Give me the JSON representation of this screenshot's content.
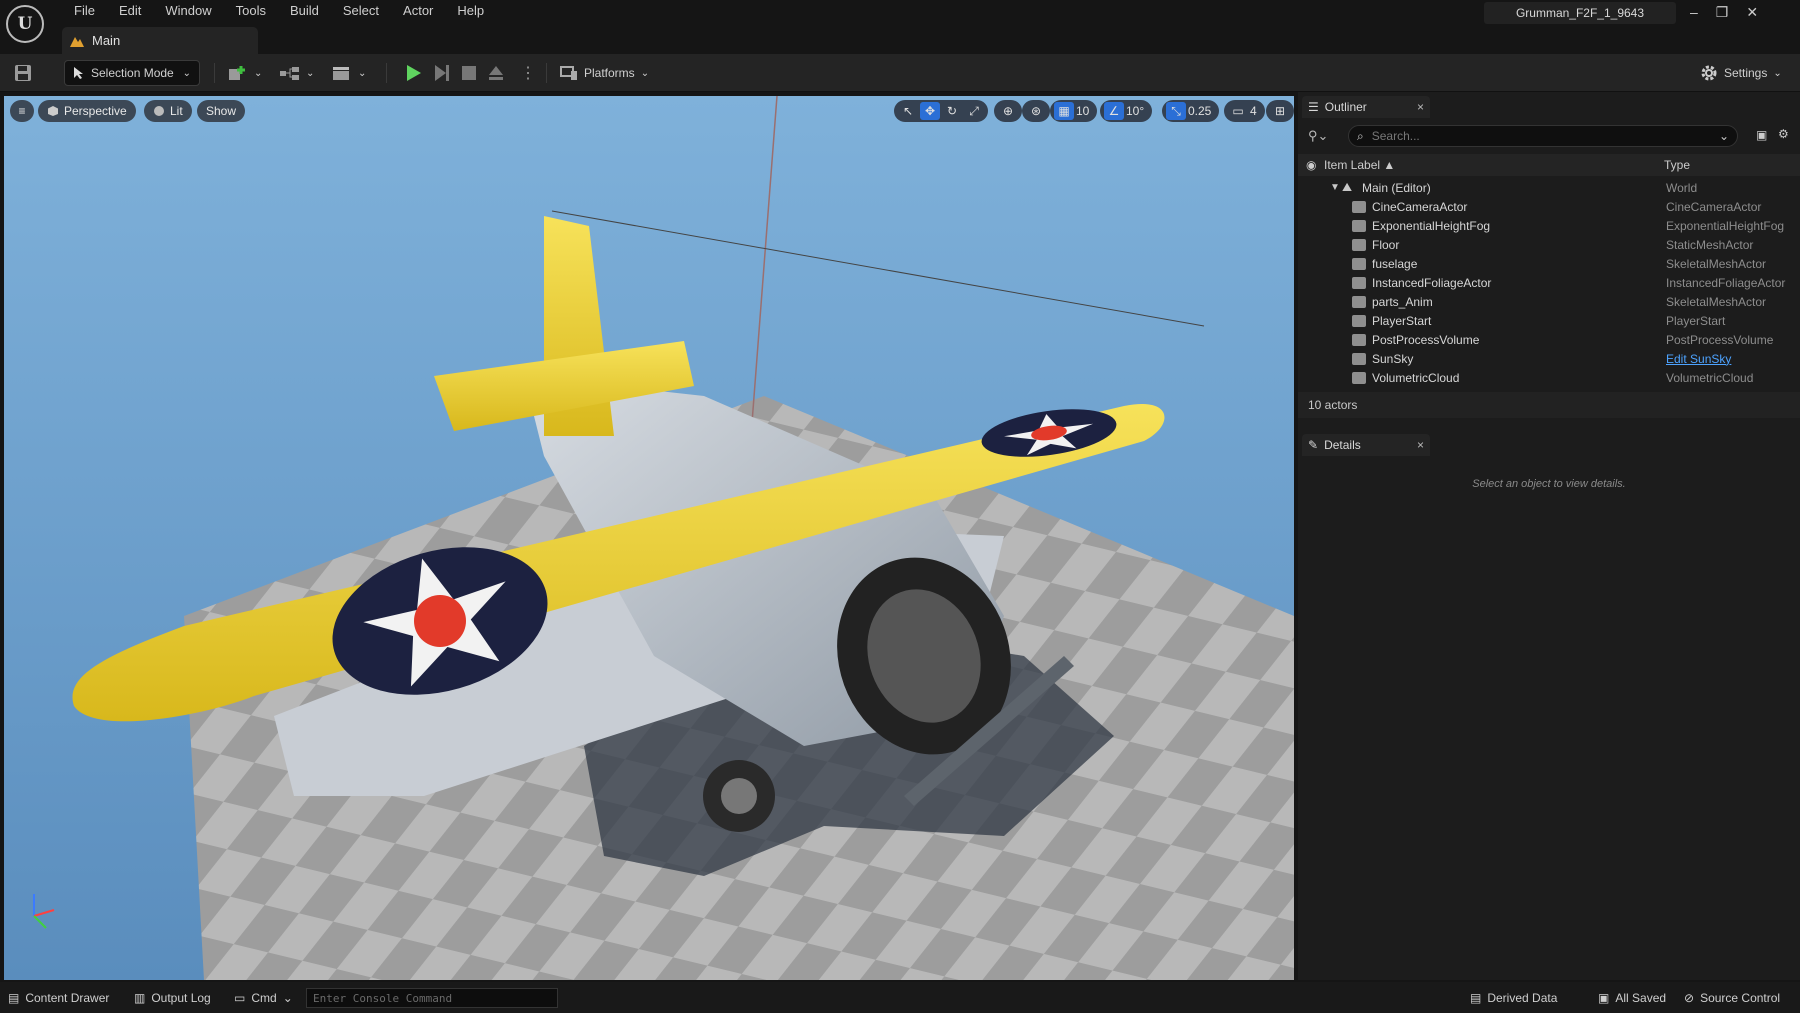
{
  "menu": {
    "items": [
      "File",
      "Edit",
      "Window",
      "Tools",
      "Build",
      "Select",
      "Actor",
      "Help"
    ]
  },
  "app": {
    "logo": "U",
    "project_name": "Grumman_F2F_1_9643",
    "doc_tab": "Main"
  },
  "window_controls": {
    "minimize": "–",
    "restore": "❐",
    "close": "✕"
  },
  "toolbar": {
    "selection_mode": "Selection Mode",
    "platforms": "Platforms",
    "settings": "Settings"
  },
  "viewport": {
    "menu_icon": "≡",
    "perspective": "Perspective",
    "lit": "Lit",
    "show": "Show",
    "grid_snap": "10",
    "rotate_snap": "10°",
    "scale_snap": "0.25",
    "camera_speed": "4"
  },
  "outliner": {
    "title": "Outliner",
    "close": "×",
    "search_placeholder": "Search...",
    "col_label": "Item Label ▲",
    "col_type": "Type",
    "root": {
      "label": "Main (Editor)",
      "type": "World"
    },
    "rows": [
      {
        "label": "CineCameraActor",
        "type": "CineCameraActor"
      },
      {
        "label": "ExponentialHeightFog",
        "type": "ExponentialHeightFog"
      },
      {
        "label": "Floor",
        "type": "StaticMeshActor"
      },
      {
        "label": "fuselage",
        "type": "SkeletalMeshActor"
      },
      {
        "label": "InstancedFoliageActor",
        "type": "InstancedFoliageActor"
      },
      {
        "label": "parts_Anim",
        "type": "SkeletalMeshActor"
      },
      {
        "label": "PlayerStart",
        "type": "PlayerStart"
      },
      {
        "label": "PostProcessVolume",
        "type": "PostProcessVolume"
      },
      {
        "label": "SunSky",
        "type": "Edit SunSky"
      },
      {
        "label": "VolumetricCloud",
        "type": "VolumetricCloud"
      }
    ],
    "count": "10 actors"
  },
  "details": {
    "title": "Details",
    "close": "×",
    "hint": "Select an object to view details."
  },
  "statusbar": {
    "content_drawer": "Content Drawer",
    "output_log": "Output Log",
    "cmd": "Cmd",
    "console_placeholder": "Enter Console Command",
    "derived_data": "Derived Data",
    "all_saved": "All Saved",
    "source_control": "Source Control"
  },
  "colors": {
    "sky": "#6f9fcb",
    "wing": "#f1d430",
    "roundel": "#1c2140",
    "accent_blue": "#2b6fd6",
    "link": "#4da3ff"
  }
}
